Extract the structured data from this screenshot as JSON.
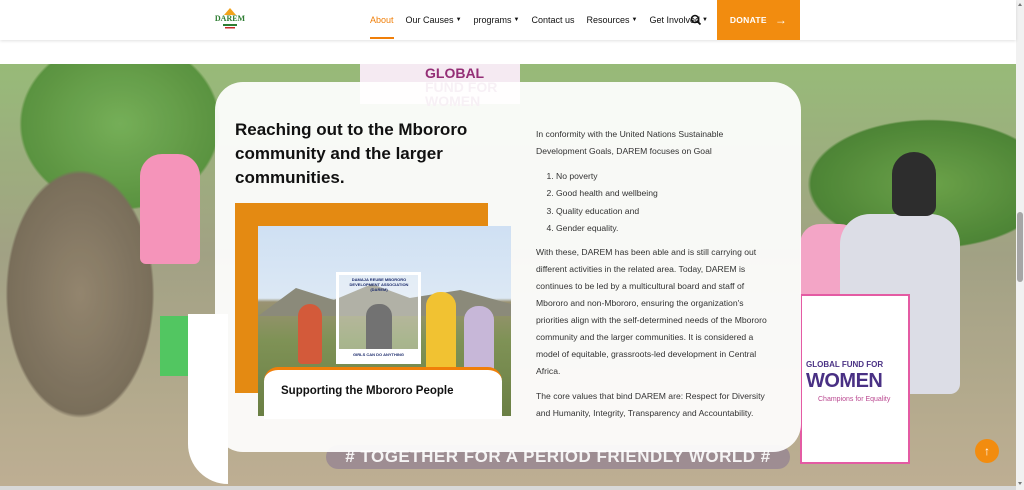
{
  "header": {
    "logo_text": "DAREM",
    "nav": [
      {
        "label": "About",
        "dropdown": false,
        "active": true
      },
      {
        "label": "Our Causes",
        "dropdown": true,
        "active": false
      },
      {
        "label": "programs",
        "dropdown": true,
        "active": false
      },
      {
        "label": "Contact us",
        "dropdown": false,
        "active": false
      },
      {
        "label": "Resources",
        "dropdown": true,
        "active": false
      },
      {
        "label": "Get Involved",
        "dropdown": true,
        "active": false
      }
    ],
    "donate_label": "DONATE"
  },
  "hero": {
    "banner_top_text": "GLOBAL FUND FOR WOMEN",
    "banner_right_line1": "GLOBAL FUND FOR",
    "banner_right_line2": "WOMEN",
    "banner_right_line3": "Champions for Equality",
    "hashtag": "# TOGETHER FOR A PERIOD FRIENDLY WORLD #"
  },
  "card": {
    "title": "Reaching out to the Mbororo community and the larger communities.",
    "photo": {
      "frame_header": "DAMAJA REUBE MBORORO DEVELOPMENT ASSOCIATION (DAREM)",
      "frame_footer": "GIRLS CAN DO ANYTHING"
    },
    "caption": "Supporting the Mbororo People",
    "intro": "In conformity with the United Nations Sustainable Development Goals, DAREM focuses on Goal",
    "goals": [
      "No poverty",
      "Good health and wellbeing",
      "Quality education and",
      "Gender equality."
    ],
    "paragraph1": " With these, DAREM has been able and is still carrying out different activities in the related area. Today, DAREM is continues to be led by a multicultural board and staff of Mbororo and non-Mbororo, ensuring the organization's priorities align with the self-determined needs of the Mbororo community and the larger communities. It is considered a model of equitable, grassroots-led development in Central Africa.",
    "paragraph2": "The core values that bind DAREM are: Respect for Diversity and Humanity, Integrity, Transparency and Accountability."
  },
  "colors": {
    "accent": "#f28c0f",
    "active_nav": "#f07f09"
  }
}
